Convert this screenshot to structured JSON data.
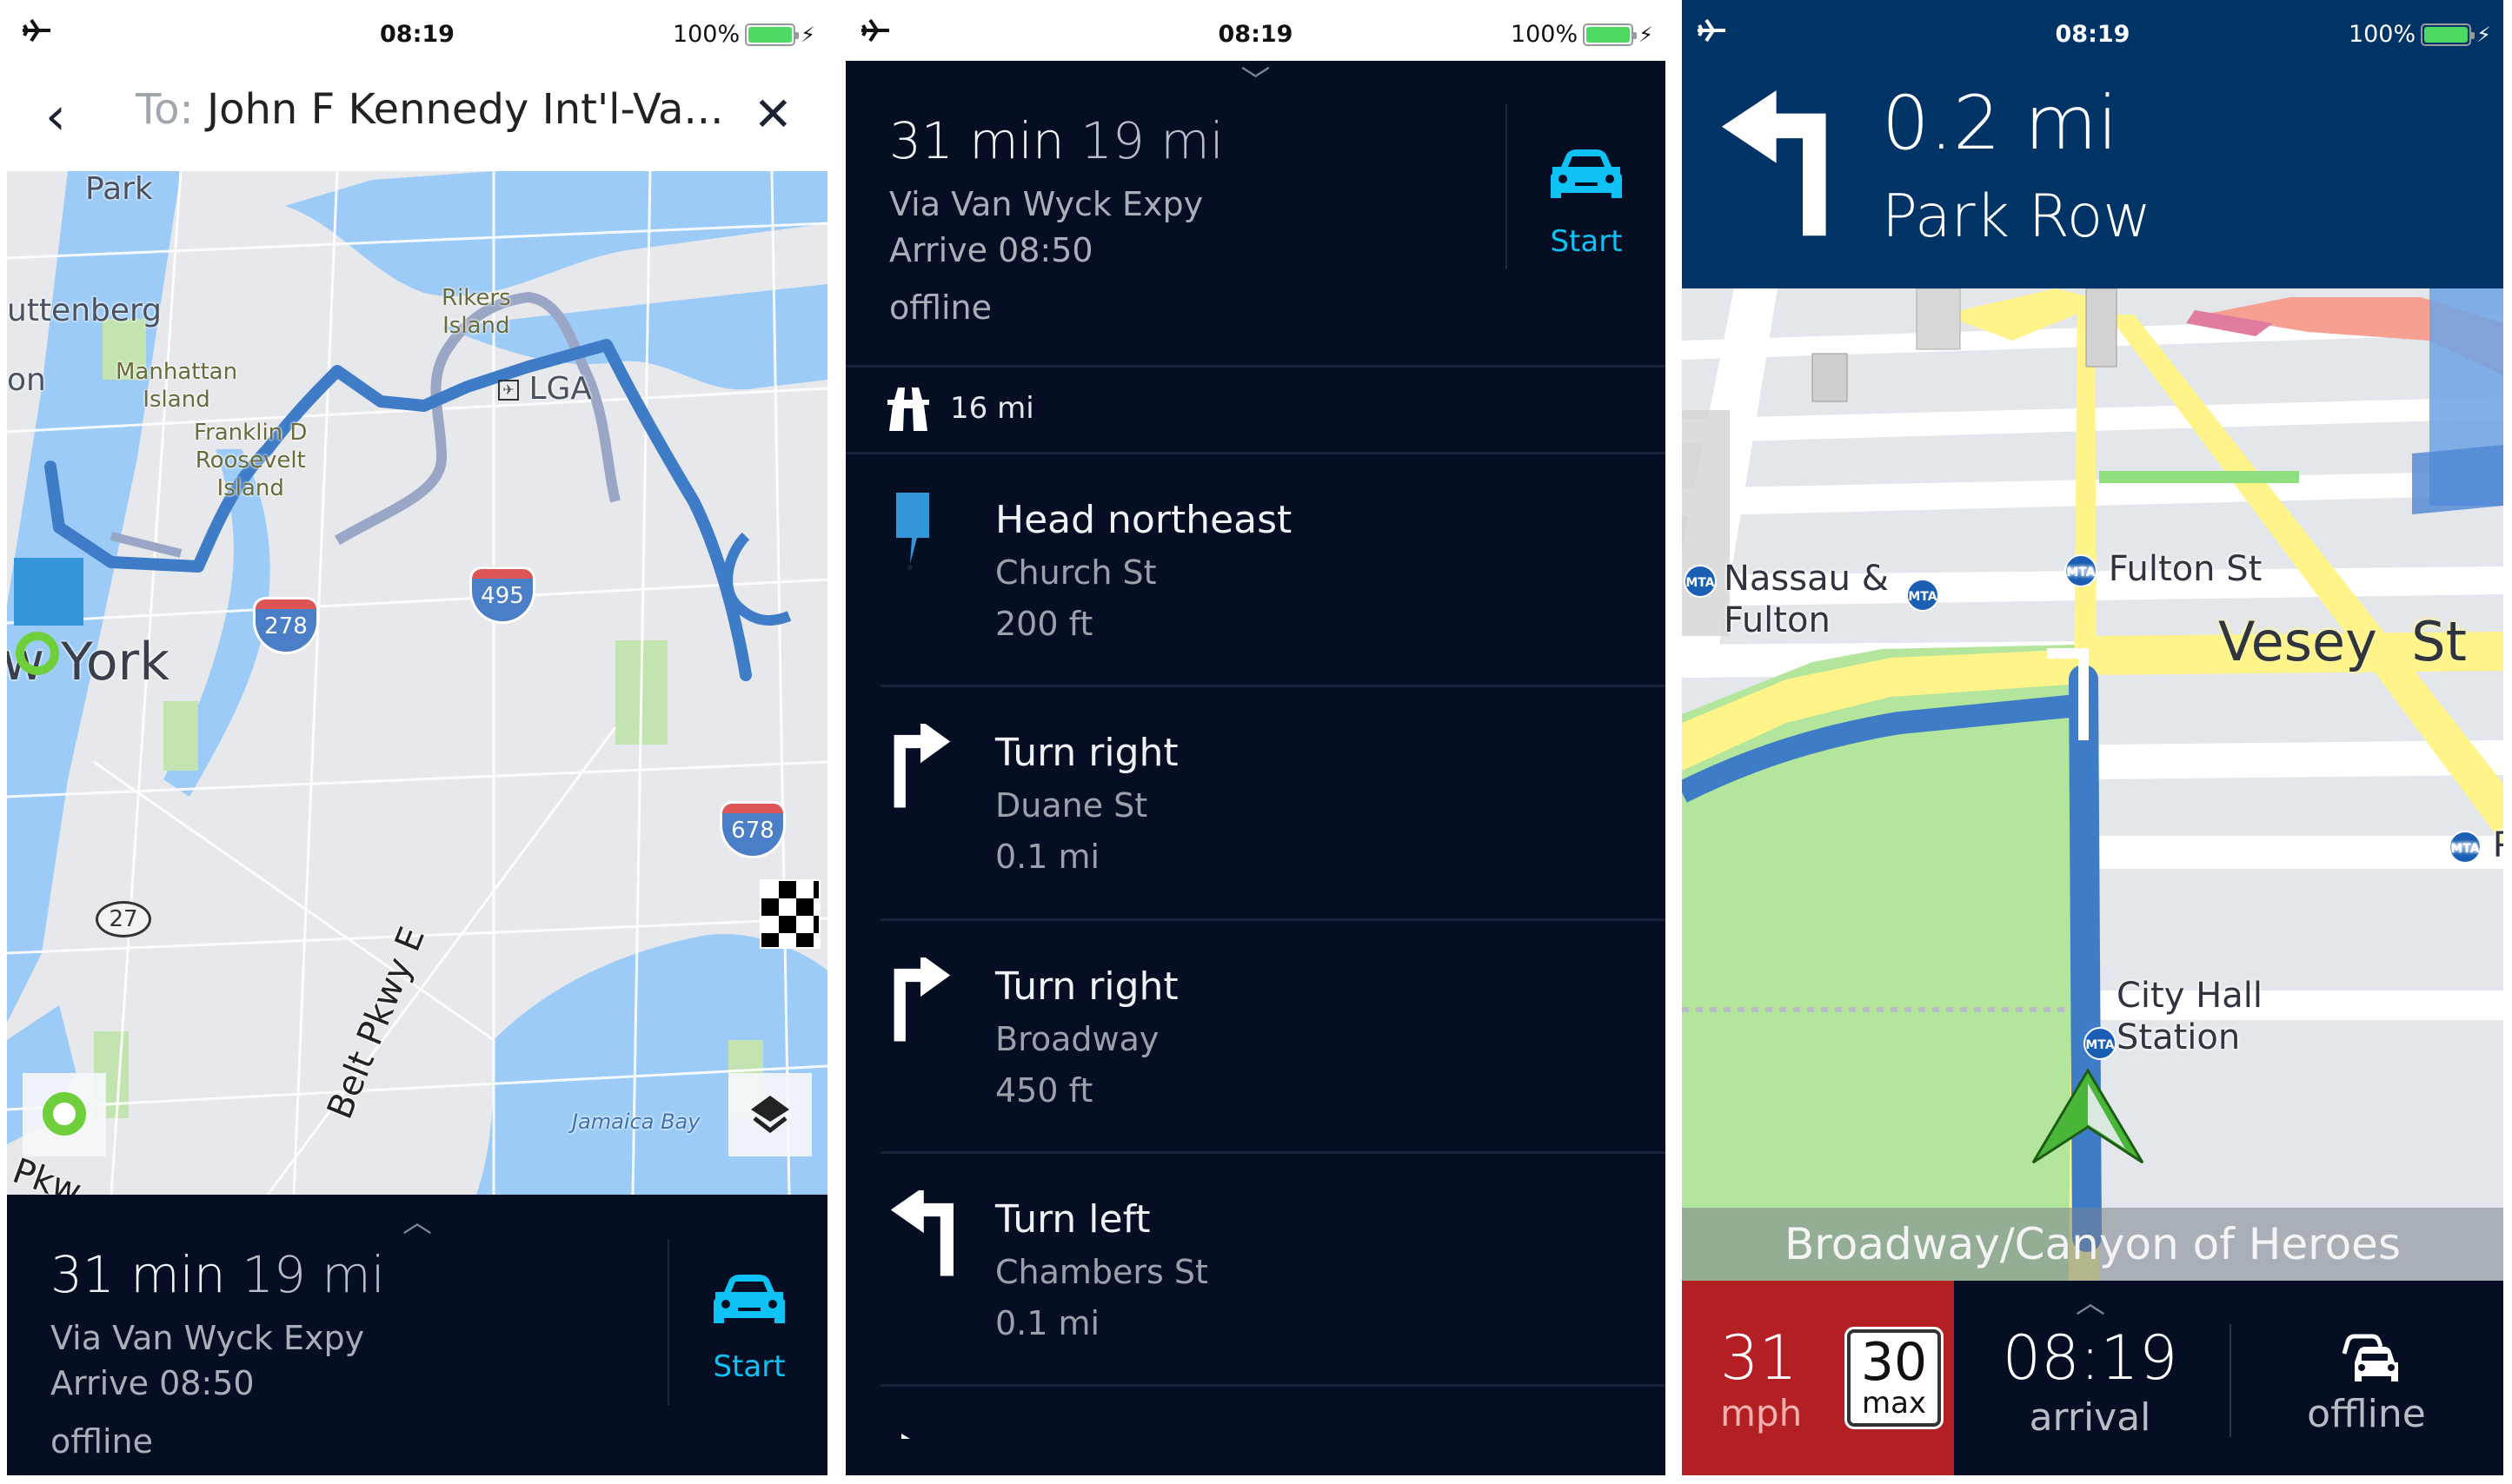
{
  "status_bar": {
    "time": "08:19",
    "battery": "100%",
    "battery_level": 1.0,
    "icons": [
      "airplane-mode-icon",
      "battery-icon",
      "charging-bolt-icon"
    ]
  },
  "route_overview": {
    "header": {
      "prefix": "To:",
      "destination": "John F Kennedy Int'l-Va...",
      "back_icon": "chevron-left-icon",
      "close_icon": "close-icon"
    },
    "map": {
      "labels": {
        "park": "Park",
        "guttenberg": "uttenberg",
        "edge_on": "on",
        "rikers": "Rikers\nIsland",
        "manhattan": "Manhattan\nIsland",
        "roosevelt": "Franklin D\nRoosevelt\nIsland",
        "lga": "LGA",
        "new_york": "w York",
        "jamaica_bay": "Jamaica Bay",
        "belt_pkwy": "Belt Pkwy E",
        "pkwy_edge": "Pkw"
      },
      "shields": {
        "i278": "278",
        "i495": "495",
        "i678": "678",
        "ny27": "27"
      },
      "buttons": {
        "locate": "my-location-button",
        "layers": "map-layers-button"
      }
    },
    "summary": {
      "duration": "31 min",
      "distance": "19 mi",
      "via": "Via Van Wyck Expy",
      "arrive": "Arrive 08:50",
      "mode": "offline",
      "start_label": "Start"
    }
  },
  "route_list": {
    "summary": {
      "duration": "31 min",
      "distance": "19 mi",
      "via": "Via Van Wyck Expy",
      "arrive": "Arrive 08:50",
      "mode": "offline",
      "start_label": "Start"
    },
    "highway_distance": "16 mi",
    "steps": [
      {
        "instruction": "Head northeast",
        "street": "Church St",
        "distance": "200 ft",
        "icon": "start-flag-icon"
      },
      {
        "instruction": "Turn right",
        "street": "Duane St",
        "distance": "0.1 mi",
        "icon": "turn-right-icon"
      },
      {
        "instruction": "Turn right",
        "street": "Broadway",
        "distance": "450 ft",
        "icon": "turn-right-icon"
      },
      {
        "instruction": "Turn left",
        "street": "Chambers St",
        "distance": "0.1 mi",
        "icon": "turn-left-icon"
      }
    ]
  },
  "navigation": {
    "next_turn": {
      "distance": "0.2 mi",
      "street": "Park Row",
      "icon": "turn-left-icon"
    },
    "map_labels": {
      "nassau": "Nassau &\nFulton",
      "fulton_st": "Fulton St",
      "vesey": "Vesey  St",
      "city_hall": "City Hall\nStation",
      "pa": "Pa",
      "mta": "MTA"
    },
    "current_street": "Broadway/Canyon of Heroes",
    "speed": {
      "value": "31",
      "unit": "mph"
    },
    "speed_limit": {
      "value": "30",
      "unit": "max"
    },
    "arrival": {
      "value": "08:19",
      "label": "arrival"
    },
    "traffic": {
      "label": "offline"
    }
  },
  "colors": {
    "dark_bg": "#060e24",
    "nav_blue": "#003366",
    "accent_cyan": "#0fc2f5",
    "route_blue": "#3f7cc8",
    "speed_red": "#b31f22",
    "water": "#9ccbf7",
    "park_green": "#b3e59d"
  }
}
